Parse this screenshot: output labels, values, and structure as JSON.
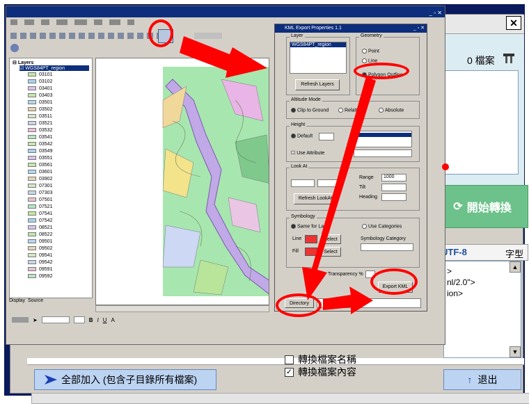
{
  "converter": {
    "file_count": "0 檔案",
    "convert_button": "開始轉換",
    "encoding": "UTF-8",
    "font_label": "字型",
    "xml_lines": [
      ">",
      "nl/2.0\">",
      "",
      "",
      "",
      "ion>"
    ],
    "add_all_button": "全部加入 (包含子目錄所有檔案)",
    "checkbox_filename": "轉換檔案名稱",
    "checkbox_content": "轉換檔案內容",
    "exit_button": "退出"
  },
  "arcmap": {
    "title": "",
    "toc_root": "Layers",
    "toc_layer": "WGS84PT_region",
    "toc_legend_items": [
      "03101",
      "03102",
      "03401",
      "03403",
      "03501",
      "03502",
      "03511",
      "03521",
      "03532",
      "03541",
      "03542",
      "03549",
      "03551",
      "03561",
      "03601",
      "03902",
      "07301",
      "07303",
      "07501",
      "07521",
      "07541",
      "07542",
      "08521",
      "08522",
      "09501",
      "09502",
      "09541",
      "09542",
      "09591",
      "09592"
    ],
    "toc_tab_display": "Display",
    "toc_tab_source": "Source"
  },
  "kml_dialog": {
    "title": "KML Export Properties 1.1",
    "layer_label": "Layer",
    "layer_item": "WGS84PT_region",
    "refresh_button": "Refresh Layers",
    "geometry_label": "Geometry",
    "geometry_options": [
      "Point",
      "Line",
      "Polygon Outline"
    ],
    "altitude_label": "Altitude Mode",
    "altitude_options": [
      "Clip to Ground",
      "Relative",
      "Absolute"
    ],
    "height_label": "Height",
    "default_label": "Default",
    "use_attr_label": "Use Attribute",
    "lookat_label": "Look At",
    "range_label": "Range",
    "range_value": "1000",
    "tilt_label": "Tilt",
    "heading_label": "Heading",
    "refresh_lookat": "Refresh LookAt",
    "symbology_label": "Symbology",
    "same_layer_label": "Same for Layer",
    "use_categories_label": "Use Categories",
    "line_label": "Line",
    "fill_label": "Fill",
    "select_label": "Select",
    "symbology_category": "Symbology Category",
    "transparency_label": "Transparency %",
    "export_button": "Export KML",
    "directory_button": "Directory"
  },
  "colors": {
    "annotation": "#ff0000",
    "convert_green": "#6cc28a",
    "map_green": "#a8e6b0",
    "map_river": "#c1a9e8"
  }
}
